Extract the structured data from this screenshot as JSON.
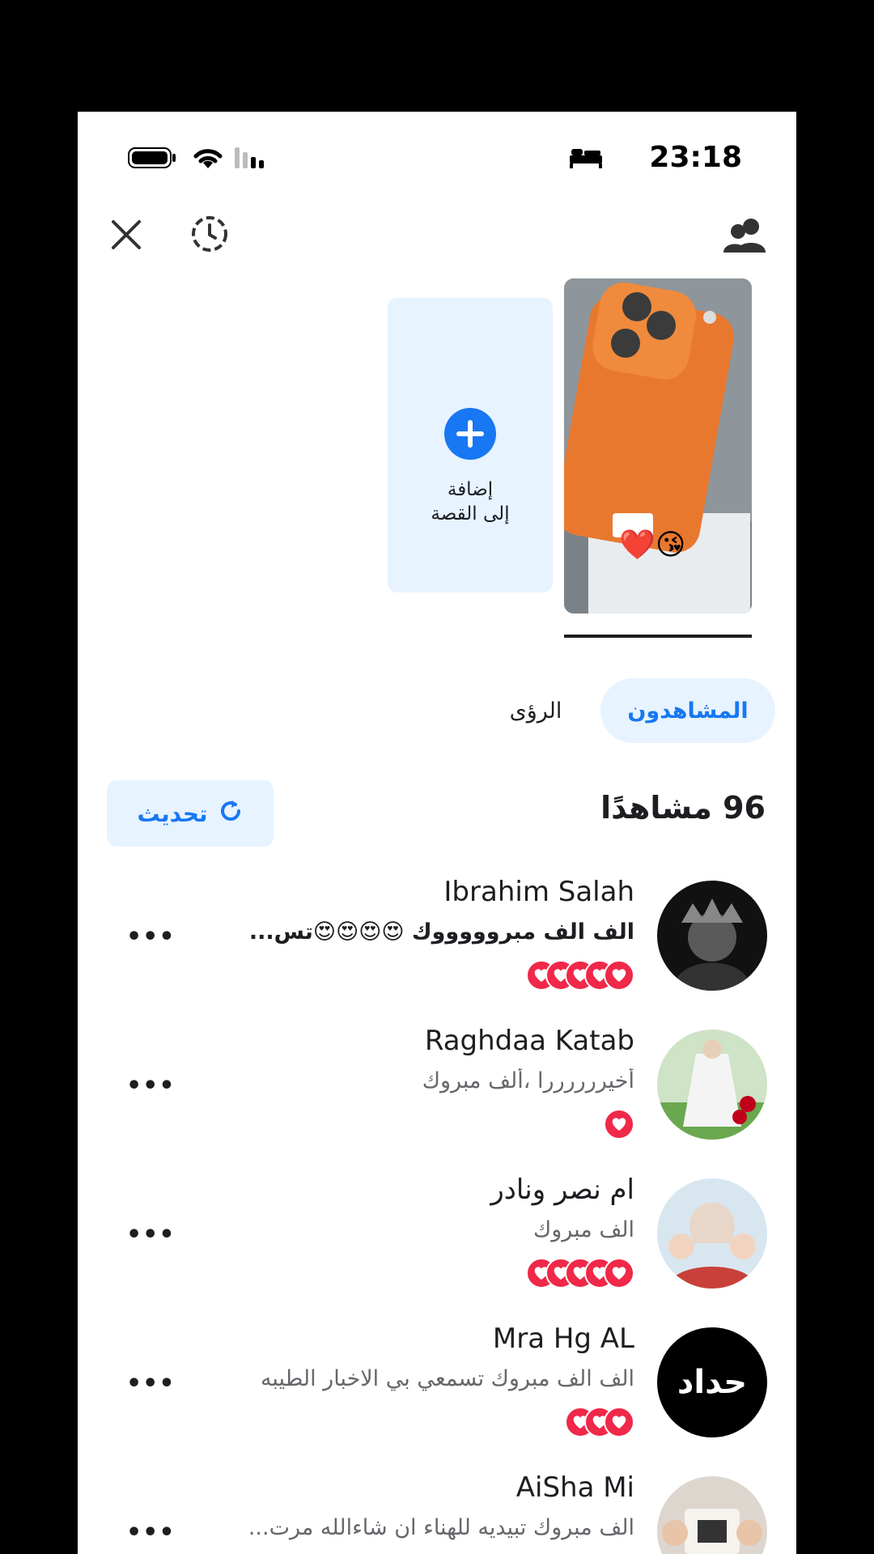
{
  "status_bar": {
    "time": "23:18"
  },
  "story": {
    "add_label_line1": "إضافة",
    "add_label_line2": "إلى القصة",
    "emoji": "❤️😘"
  },
  "tabs": [
    {
      "label": "المشاهدون"
    },
    {
      "label": "الرؤى"
    }
  ],
  "viewers": {
    "count_label": "96 مشاهدًا",
    "refresh_label": "تحديث",
    "rows": [
      {
        "name": "Ibrahim Salah",
        "reply": "الف الف مبروووووك 😍😍😍😍تس...",
        "hearts": 5
      },
      {
        "name": "Raghdaa Katab",
        "reply": "أخيررررررا ،ألف مبروك",
        "hearts": 1
      },
      {
        "name": "ام نصر ونادر",
        "reply": "الف مبروك",
        "hearts": 5
      },
      {
        "name": "Mra Hg AL",
        "reply": "الف الف مبروك تسمعي بي الاخبار الطيبه",
        "hearts": 3
      },
      {
        "name": "AiSha Mi",
        "reply": "الف مبروك تبيديه للهناء ان شاءالله مرت...",
        "hearts": 0
      }
    ],
    "avatar_text_row4": "حداد",
    "more_label": "•••"
  },
  "colors": {
    "accent": "#1877f2",
    "heart": "#f02849"
  }
}
